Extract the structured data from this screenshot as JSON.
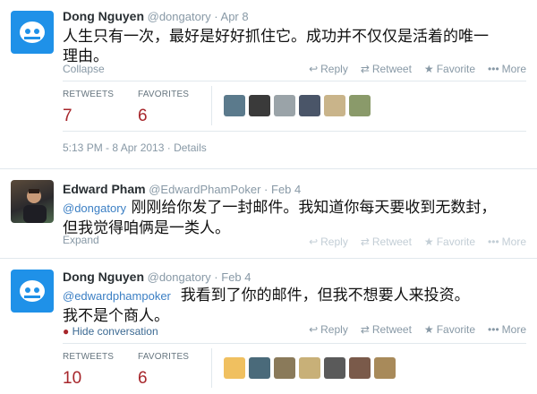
{
  "actions": {
    "reply": "Reply",
    "retweet": "Retweet",
    "favorite": "Favorite",
    "more": "More"
  },
  "tweets": [
    {
      "name": "Dong Nguyen",
      "screen_name": "@dongatory",
      "date": "Apr 8",
      "text_line1": "人生只有一次，最好是好好抓住它。成功并不仅仅是活着的唯一",
      "text_line2": "理由。",
      "toggle": "Collapse",
      "stats": {
        "retweets_label": "RETWEETS",
        "retweets": "7",
        "favorites_label": "FAVORITES",
        "favorites": "6"
      },
      "meta": "5:13 PM - 8 Apr 2013 · Details",
      "thumb_colors": [
        "#5b7a8c",
        "#3a3a3a",
        "#9aa3a8",
        "#4a5568",
        "#c9b48a",
        "#8a9a6a"
      ]
    },
    {
      "name": "Edward Pham",
      "screen_name": "@EdwardPhamPoker",
      "date": "Feb 4",
      "mention": "@dongatory",
      "text_line1": "刚刚给你发了一封邮件。我知道你每天要收到无数封，",
      "text_line2": "但我觉得咱俩是一类人。",
      "toggle": "Expand"
    },
    {
      "name": "Dong Nguyen",
      "screen_name": "@dongatory",
      "date": "Feb 4",
      "mention": "@edwardphampoker",
      "text_line1": "我看到了你的邮件，但我不想要人来投资。",
      "text_line2": "我不是个商人。",
      "toggle": "Hide conversation",
      "stats": {
        "retweets_label": "RETWEETS",
        "retweets": "10",
        "favorites_label": "FAVORITES",
        "favorites": "6"
      },
      "thumb_colors": [
        "#f0c060",
        "#4a6a7a",
        "#8a7a5a",
        "#c8b078",
        "#5a5a5a",
        "#7a5a4a",
        "#a88a5a"
      ]
    }
  ]
}
